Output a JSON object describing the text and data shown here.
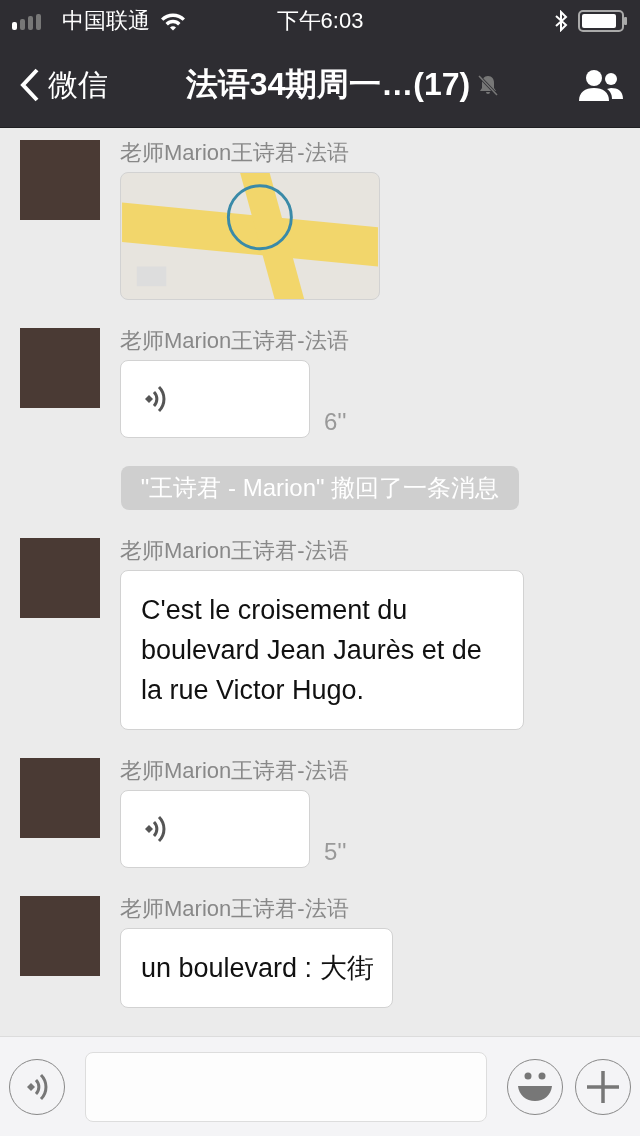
{
  "status_bar": {
    "carrier": "中国联通",
    "time": "下午6:03"
  },
  "header": {
    "back_label": "微信",
    "title": "法语34期周一…(17)",
    "muted": true
  },
  "messages": [
    {
      "kind": "location",
      "sender": "老师Marion王诗君-法语"
    },
    {
      "kind": "voice",
      "sender": "老师Marion王诗君-法语",
      "duration": "6''"
    },
    {
      "kind": "notice",
      "text": "\"王诗君 - Marion\" 撤回了一条消息"
    },
    {
      "kind": "text",
      "sender": "老师Marion王诗君-法语",
      "text": "C'est le croisement du boulevard Jean Jaurès et  de la rue Victor Hugo."
    },
    {
      "kind": "voice",
      "sender": "老师Marion王诗君-法语",
      "duration": "5''"
    },
    {
      "kind": "text",
      "sender": "老师Marion王诗君-法语",
      "text": "un boulevard : 大街"
    }
  ]
}
